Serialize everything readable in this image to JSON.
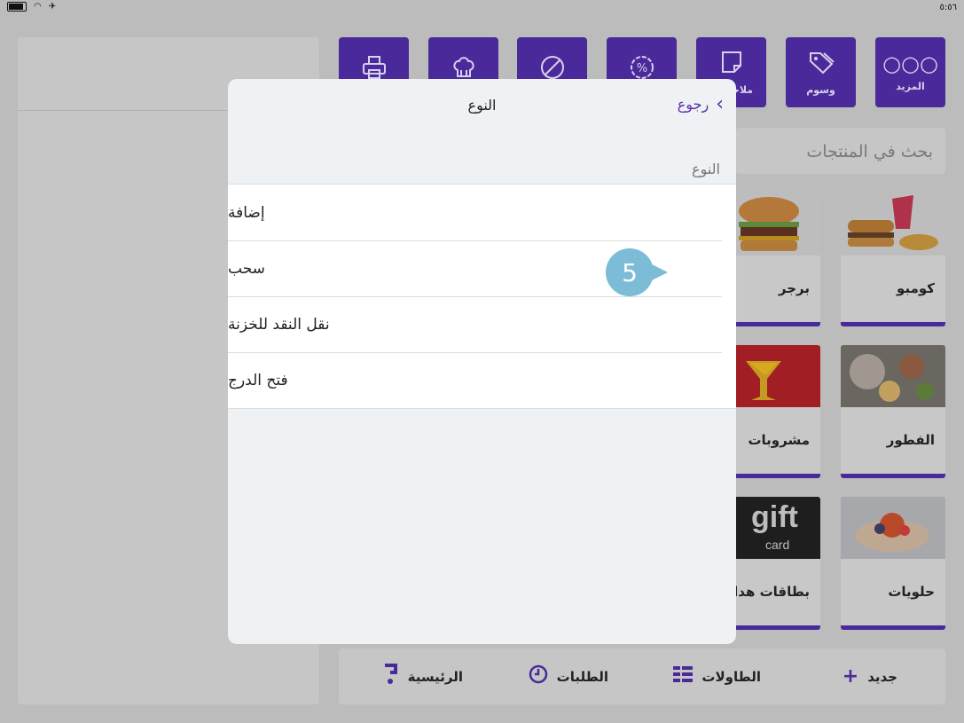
{
  "status": {
    "time": "٥:٥٦"
  },
  "toolbar": [
    {
      "label": "المزيد",
      "icon": "○○○"
    },
    {
      "label": "وسوم",
      "icon": "⌂"
    },
    {
      "label": "ملاحظات",
      "icon": "▢"
    },
    {
      "label": "",
      "icon": "%"
    },
    {
      "label": "",
      "icon": "⊘"
    },
    {
      "label": "",
      "icon": "♕"
    },
    {
      "label": "",
      "icon": "⎙"
    }
  ],
  "search": {
    "placeholder": "بحث في المنتجات"
  },
  "products": [
    {
      "name": "كومبو"
    },
    {
      "name": "برجر"
    },
    {
      "name": "الفطور"
    },
    {
      "name": "مشروبات"
    },
    {
      "name": "حلويات"
    },
    {
      "name": "بطاقات هدايا"
    }
  ],
  "gift_card": {
    "word": "gift",
    "sub": "card"
  },
  "bottom_nav": {
    "new": "جديد",
    "tables": "الطاولات",
    "orders": "الطلبات",
    "home": "الرئيسية"
  },
  "modal": {
    "title": "النوع",
    "back_label": "رجوع",
    "section_label": "النوع",
    "options": [
      "إضافة",
      "سحب",
      "نقل النقد للخزنة",
      "فتح الدرج"
    ]
  },
  "callout": {
    "number": "5"
  },
  "colors": {
    "brand": "#4a2a9a",
    "accent": "#5b2ea6",
    "callout": "#7cbcd6"
  }
}
